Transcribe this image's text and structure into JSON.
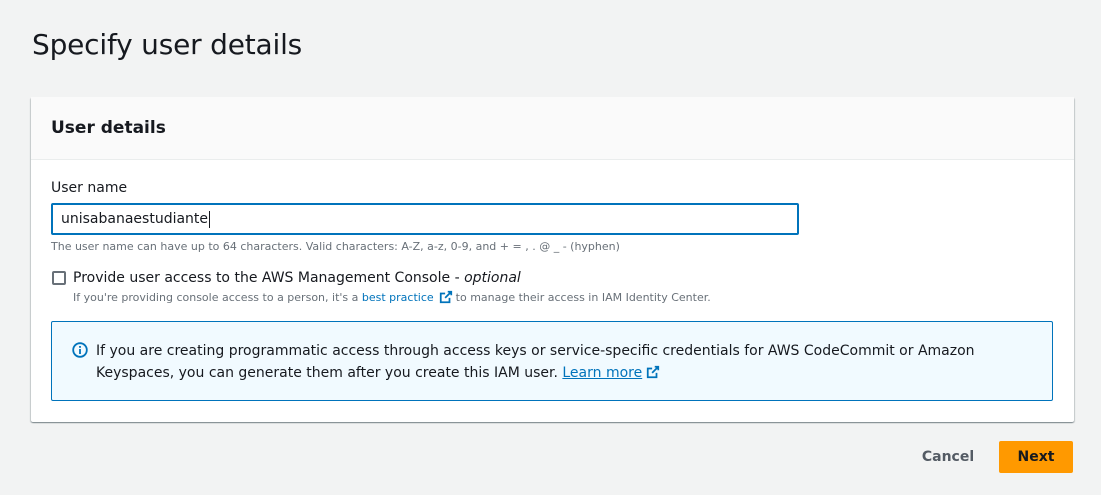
{
  "page": {
    "title": "Specify user details"
  },
  "user_details": {
    "header": "User details",
    "username_label": "User name",
    "username_value": "unisabanaestudiante",
    "username_constraint": "The user name can have up to 64 characters. Valid characters: A-Z, a-z, 0-9, and + = , . @ _ - (hyphen)",
    "console_access": {
      "checked": false,
      "label": "Provide user access to the AWS Management Console - ",
      "optional": "optional",
      "desc_before": "If you're providing console access to a person, it's a ",
      "desc_link": "best practice",
      "desc_after": " to manage their access in IAM Identity Center."
    },
    "info_alert": {
      "text": "If you are creating programmatic access through access keys or service-specific credentials for AWS CodeCommit or Amazon Keyspaces, you can generate them after you create this IAM user. ",
      "link": "Learn more"
    }
  },
  "actions": {
    "cancel": "Cancel",
    "next": "Next"
  },
  "colors": {
    "primary_button": "#ff9900",
    "link": "#0073bb",
    "focus_border": "#0073bb",
    "info_background": "#f1faff"
  },
  "icons": {
    "external_link": "external-link-icon",
    "info": "info-icon"
  }
}
